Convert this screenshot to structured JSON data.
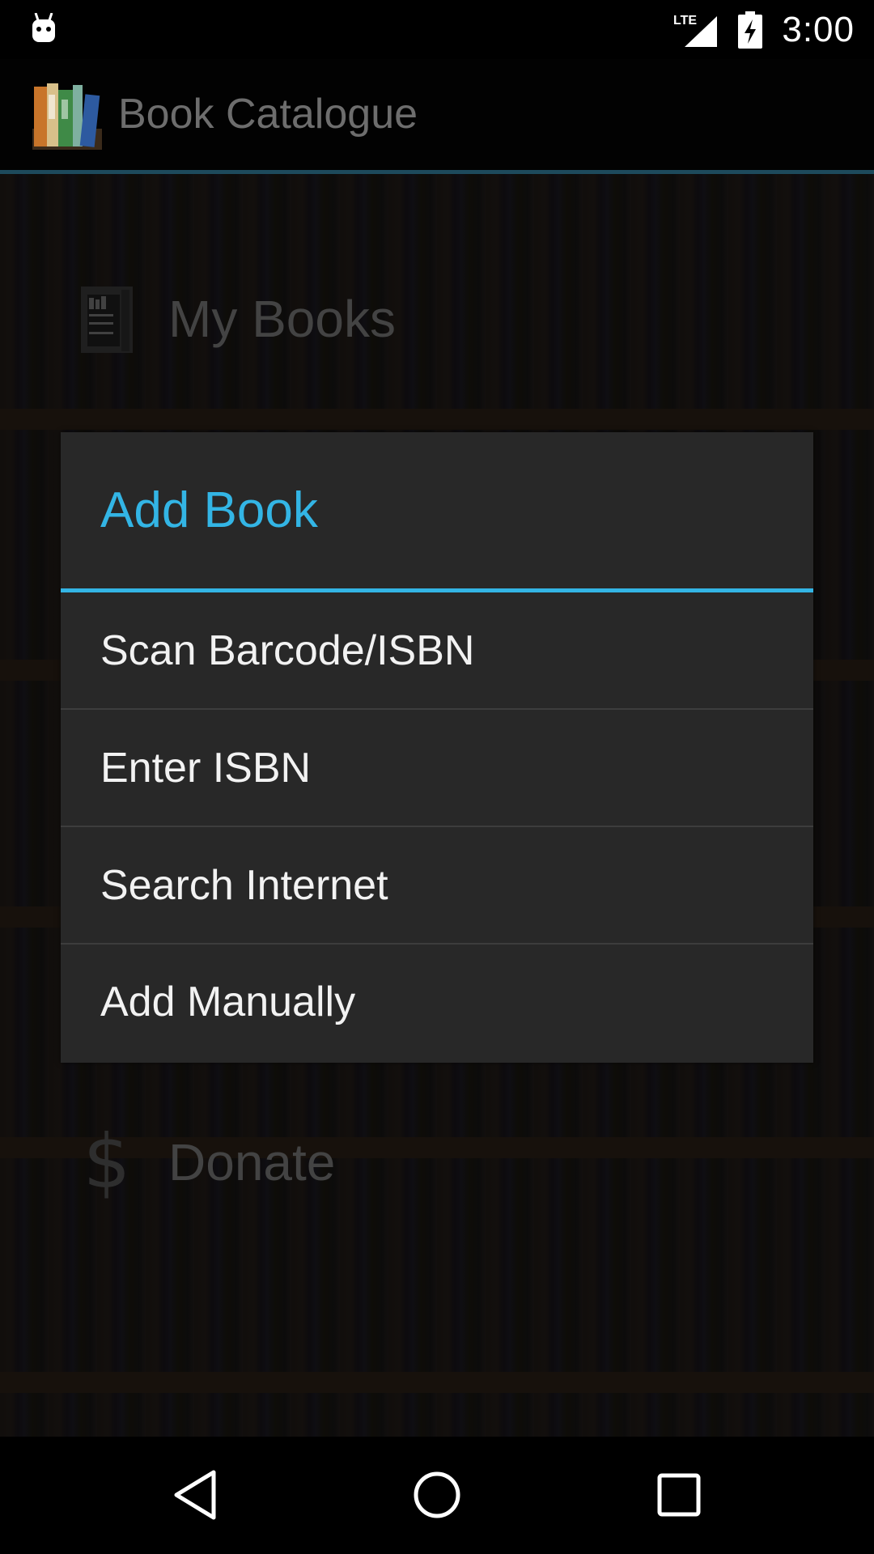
{
  "status_bar": {
    "notification_icon": "android-debug-icon",
    "network_label": "LTE",
    "time": "3:00"
  },
  "action_bar": {
    "title": "Book Catalogue",
    "logo_icon": "books-logo-icon"
  },
  "background_menu": {
    "items": [
      {
        "label": "My Books",
        "icon": "bookshelf-icon"
      },
      {
        "label": "Donate",
        "icon": "dollar-icon"
      }
    ]
  },
  "dialog": {
    "title": "Add Book",
    "accent_color": "#33b5e5",
    "options": [
      {
        "label": "Scan Barcode/ISBN"
      },
      {
        "label": "Enter ISBN"
      },
      {
        "label": "Search Internet"
      },
      {
        "label": "Add Manually"
      }
    ]
  },
  "nav_bar": {
    "buttons": [
      "back-icon",
      "home-icon",
      "recents-icon"
    ]
  }
}
